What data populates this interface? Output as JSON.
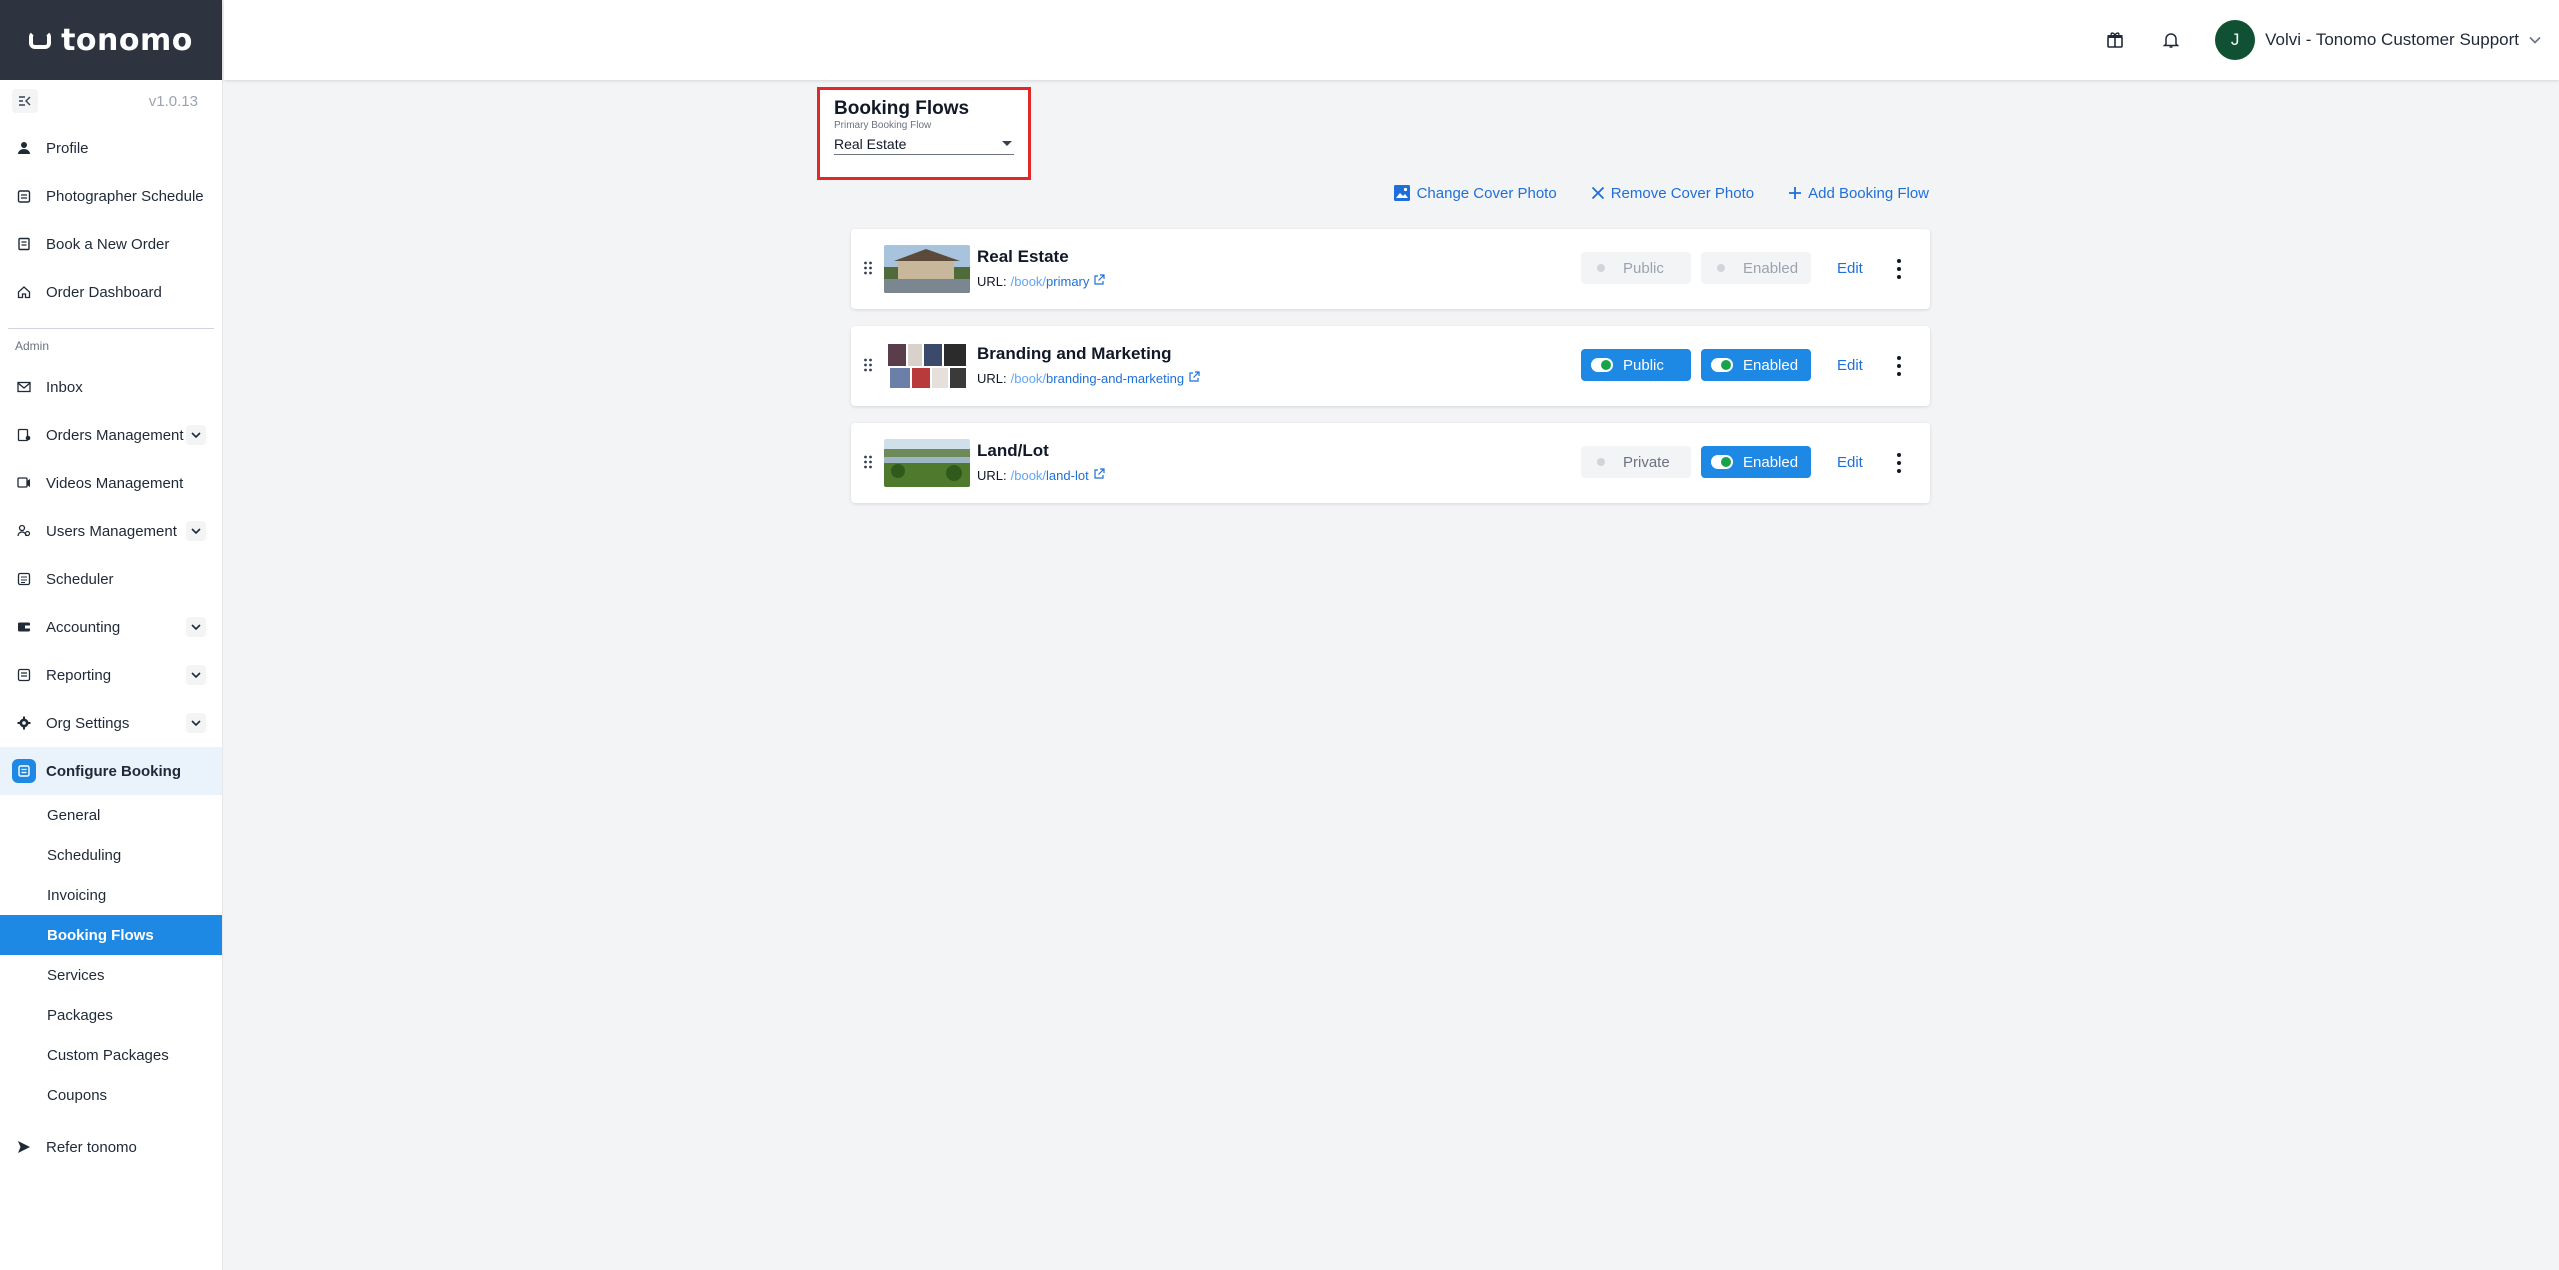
{
  "brand": {
    "name": "tonomo",
    "version": "v1.0.13"
  },
  "sidebar": {
    "top_items": [
      {
        "label": "Profile",
        "icon": "person-icon"
      },
      {
        "label": "Photographer Schedule",
        "icon": "calendar-icon"
      },
      {
        "label": "Book a New Order",
        "icon": "book-icon"
      },
      {
        "label": "Order Dashboard",
        "icon": "home-icon"
      }
    ],
    "section_label": "Admin",
    "admin_items": [
      {
        "label": "Inbox",
        "icon": "mail-icon",
        "expandable": false
      },
      {
        "label": "Orders Management",
        "icon": "orders-icon",
        "expandable": true
      },
      {
        "label": "Videos Management",
        "icon": "video-icon",
        "expandable": false
      },
      {
        "label": "Users Management",
        "icon": "users-icon",
        "expandable": true
      },
      {
        "label": "Scheduler",
        "icon": "scheduler-icon",
        "expandable": false
      },
      {
        "label": "Accounting",
        "icon": "wallet-icon",
        "expandable": true
      },
      {
        "label": "Reporting",
        "icon": "report-icon",
        "expandable": true
      },
      {
        "label": "Org Settings",
        "icon": "gear-icon",
        "expandable": true
      }
    ],
    "active_parent": {
      "label": "Configure Booking",
      "icon": "configure-icon"
    },
    "sub_items": [
      {
        "label": "General"
      },
      {
        "label": "Scheduling"
      },
      {
        "label": "Invoicing"
      },
      {
        "label": "Booking Flows"
      },
      {
        "label": "Services"
      },
      {
        "label": "Packages"
      },
      {
        "label": "Custom Packages"
      },
      {
        "label": "Coupons"
      }
    ],
    "selected_sub": "Booking Flows",
    "refer": {
      "label": "Refer tonomo",
      "icon": "send-icon"
    }
  },
  "topbar": {
    "user_initial": "J",
    "user_name": "Volvi - Tonomo Customer Support"
  },
  "page": {
    "title": "Booking Flows",
    "primary_label": "Primary Booking Flow",
    "primary_value": "Real Estate"
  },
  "actions": {
    "change_cover": "Change Cover Photo",
    "remove_cover": "Remove Cover Photo",
    "add_flow": "Add Booking Flow"
  },
  "flows": [
    {
      "name": "Real Estate",
      "url_label": "URL:",
      "url_prefix": "/book/",
      "url_slug": "primary",
      "visibility": "Public",
      "visibility_on": false,
      "status": "Enabled",
      "status_on": false,
      "edit": "Edit",
      "disabled": true
    },
    {
      "name": "Branding and Marketing",
      "url_label": "URL:",
      "url_prefix": "/book/",
      "url_slug": "branding-and-marketing",
      "visibility": "Public",
      "visibility_on": true,
      "status": "Enabled",
      "status_on": true,
      "edit": "Edit",
      "disabled": false
    },
    {
      "name": "Land/Lot",
      "url_label": "URL:",
      "url_prefix": "/book/",
      "url_slug": "land-lot",
      "visibility": "Private",
      "visibility_on": false,
      "status": "Enabled",
      "status_on": true,
      "edit": "Edit",
      "disabled": false
    }
  ],
  "colors": {
    "accent": "#1e88e5",
    "sidebar_header": "#2e3340",
    "highlight_border": "#e12828",
    "avatar": "#0f5132"
  }
}
